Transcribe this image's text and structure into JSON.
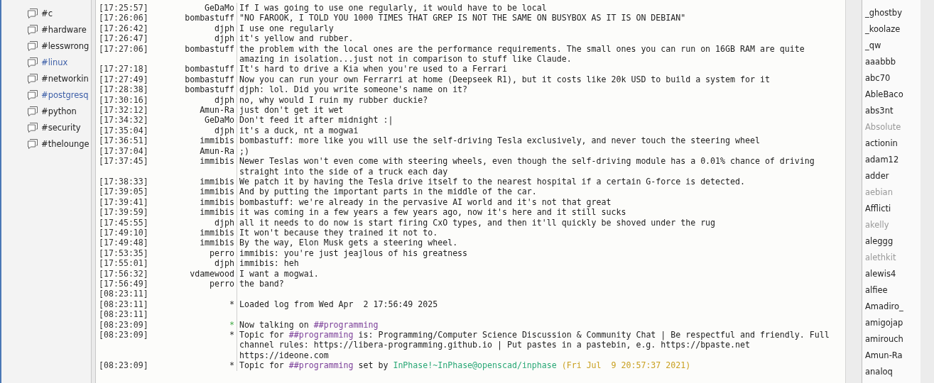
{
  "channels": [
    {
      "name": "#c",
      "unread": false
    },
    {
      "name": "#hardware",
      "unread": false
    },
    {
      "name": "#lesswrong",
      "unread": false
    },
    {
      "name": "#linux",
      "unread": true
    },
    {
      "name": "#networkin",
      "unread": false
    },
    {
      "name": "#postgresq",
      "unread": true
    },
    {
      "name": "#python",
      "unread": false
    },
    {
      "name": "#security",
      "unread": false
    },
    {
      "name": "#thelounge",
      "unread": false
    }
  ],
  "messages": [
    {
      "time": "[17:25:57]",
      "nick": "GeDaMo",
      "kind": "chat",
      "parts": [
        {
          "kind": "text",
          "text": "If I was going to use one regularly, it would have to be local"
        }
      ]
    },
    {
      "time": "[17:26:06]",
      "nick": "bombastuff",
      "kind": "chat",
      "parts": [
        {
          "kind": "text",
          "text": "\"NO FAROOK, I TOLD YOU 1000 TIMES THAT GREP IS NOT THE SAME ON BUSYBOX AS IT IS ON DEBIAN\""
        }
      ]
    },
    {
      "time": "[17:26:42]",
      "nick": "djph",
      "kind": "chat",
      "parts": [
        {
          "kind": "text",
          "text": "I use one regularly"
        }
      ]
    },
    {
      "time": "[17:26:47]",
      "nick": "djph",
      "kind": "chat",
      "parts": [
        {
          "kind": "text",
          "text": "it's yellow and rubber."
        }
      ]
    },
    {
      "time": "[17:27:06]",
      "nick": "bombastuff",
      "kind": "chat",
      "parts": [
        {
          "kind": "text",
          "text": "the problem with the local ones are the performance requirements. The small ones you can run on 16GB RAM are quite amazing in isolation...just not in comparison to stuff like Claude."
        }
      ]
    },
    {
      "time": "[17:27:18]",
      "nick": "bombastuff",
      "kind": "chat",
      "parts": [
        {
          "kind": "text",
          "text": "It's hard to drive a Kia when you're used to a Ferrari"
        }
      ]
    },
    {
      "time": "[17:27:49]",
      "nick": "bombastuff",
      "kind": "chat",
      "parts": [
        {
          "kind": "text",
          "text": "Now you can run your own Ferrarri at home (Deepseek R1), but it costs like 20k USD to build a system for it"
        }
      ]
    },
    {
      "time": "[17:28:38]",
      "nick": "bombastuff",
      "kind": "chat",
      "parts": [
        {
          "kind": "text",
          "text": "djph: lol. Did you write someone's name on it?"
        }
      ]
    },
    {
      "time": "[17:30:16]",
      "nick": "djph",
      "kind": "chat",
      "parts": [
        {
          "kind": "text",
          "text": "no, why would I ruin my rubber duckie?"
        }
      ]
    },
    {
      "time": "[17:32:12]",
      "nick": "Amun-Ra",
      "kind": "chat",
      "parts": [
        {
          "kind": "text",
          "text": "just don't get it wet"
        }
      ]
    },
    {
      "time": "[17:34:32]",
      "nick": "GeDaMo",
      "kind": "chat",
      "parts": [
        {
          "kind": "text",
          "text": "Don't feed it after midnight :|"
        }
      ]
    },
    {
      "time": "[17:35:04]",
      "nick": "djph",
      "kind": "chat",
      "parts": [
        {
          "kind": "text",
          "text": "it's a duck, nt a mogwai"
        }
      ]
    },
    {
      "time": "[17:36:51]",
      "nick": "immibis",
      "kind": "chat",
      "parts": [
        {
          "kind": "text",
          "text": "bombastuff: more like you will use the self-driving Tesla exclusively, and never touch the steering wheel"
        }
      ]
    },
    {
      "time": "[17:37:04]",
      "nick": "Amun-Ra",
      "kind": "chat",
      "parts": [
        {
          "kind": "text",
          "text": ";)"
        }
      ]
    },
    {
      "time": "[17:37:45]",
      "nick": "immibis",
      "kind": "chat",
      "parts": [
        {
          "kind": "text",
          "text": "Newer Teslas won't even come with steering wheels, even though the self-driving module has a 0.01% chance of driving straight into the side of a truck each day"
        }
      ]
    },
    {
      "time": "[17:38:33]",
      "nick": "immibis",
      "kind": "chat",
      "parts": [
        {
          "kind": "text",
          "text": "We patch it by having the Tesla drive itself to the nearest hospital if a certain G-force is detected."
        }
      ]
    },
    {
      "time": "[17:39:05]",
      "nick": "immibis",
      "kind": "chat",
      "parts": [
        {
          "kind": "text",
          "text": "And by putting the important parts in the middle of the car."
        }
      ]
    },
    {
      "time": "[17:39:41]",
      "nick": "immibis",
      "kind": "chat",
      "parts": [
        {
          "kind": "text",
          "text": "bombastuff: we're already in the pervasive AI world and it's not that great"
        }
      ]
    },
    {
      "time": "[17:39:59]",
      "nick": "immibis",
      "kind": "chat",
      "parts": [
        {
          "kind": "text",
          "text": "it was coming in a few years a few years ago, now it's here and it still sucks"
        }
      ]
    },
    {
      "time": "[17:45:55]",
      "nick": "djph",
      "kind": "chat",
      "parts": [
        {
          "kind": "text",
          "text": "all it needs to do now is start firing CxO types, and then it'll quickly be shoved under the rug"
        }
      ]
    },
    {
      "time": "[17:49:10]",
      "nick": "immibis",
      "kind": "chat",
      "parts": [
        {
          "kind": "text",
          "text": "It won't because they trained it not to."
        }
      ]
    },
    {
      "time": "[17:49:48]",
      "nick": "immibis",
      "kind": "chat",
      "parts": [
        {
          "kind": "text",
          "text": "By the way, Elon Musk gets a steering wheel."
        }
      ]
    },
    {
      "time": "[17:53:35]",
      "nick": "perro",
      "kind": "chat",
      "parts": [
        {
          "kind": "text",
          "text": "immibis: you're just jeajlous of his greatness"
        }
      ]
    },
    {
      "time": "[17:55:01]",
      "nick": "djph",
      "kind": "chat",
      "parts": [
        {
          "kind": "text",
          "text": "immibis: heh"
        }
      ]
    },
    {
      "time": "[17:56:32]",
      "nick": "vdamewood",
      "kind": "chat",
      "parts": [
        {
          "kind": "text",
          "text": "I want a mogwai."
        }
      ]
    },
    {
      "time": "[17:56:49]",
      "nick": "perro",
      "kind": "chat",
      "parts": [
        {
          "kind": "text",
          "text": "the band?"
        }
      ]
    },
    {
      "time": "[08:23:11]"
    },
    {
      "time": "[08:23:11]",
      "nick": "*",
      "kind": "status",
      "parts": [
        {
          "kind": "text",
          "text": "Loaded log from Wed Apr  2 17:56:49 2025"
        }
      ]
    },
    {
      "time": "[08:23:11]"
    },
    {
      "time": "[08:23:09]",
      "nick": "*",
      "kind": "join",
      "parts": [
        {
          "kind": "text",
          "text": "Now talking on "
        },
        {
          "kind": "channel",
          "text": "##programming"
        }
      ]
    },
    {
      "time": "[08:23:09]",
      "nick": "*",
      "kind": "status",
      "parts": [
        {
          "kind": "text",
          "text": "Topic for "
        },
        {
          "kind": "channel",
          "text": "##programming"
        },
        {
          "kind": "text",
          "text": " is: Programming/Computer Science Discussion & Community Chat | Be respectful and friendly. Full channel rules: https://libera-programming.github.io | Put pastes in a pastebin, e.g. https://bpaste.net https://ideone.com"
        }
      ]
    },
    {
      "time": "[08:23:09]",
      "nick": "*",
      "kind": "status",
      "parts": [
        {
          "kind": "text",
          "text": "Topic for "
        },
        {
          "kind": "channel",
          "text": "##programming"
        },
        {
          "kind": "text",
          "text": " set by "
        },
        {
          "kind": "host",
          "text": "InPhase!~InPhase@openscad/inphase"
        },
        {
          "kind": "date",
          "text": " (Fri Jul  9 20:57:37 2021)"
        }
      ]
    }
  ],
  "users": [
    {
      "name": "_ghostby",
      "away": false
    },
    {
      "name": "_koolaze",
      "away": false
    },
    {
      "name": "_qw",
      "away": false
    },
    {
      "name": "aaabbb",
      "away": false
    },
    {
      "name": "abc70",
      "away": false
    },
    {
      "name": "AbleBaco",
      "away": false
    },
    {
      "name": "abs3nt",
      "away": false
    },
    {
      "name": "Absolute",
      "away": true
    },
    {
      "name": "actionin",
      "away": false
    },
    {
      "name": "adam12",
      "away": false
    },
    {
      "name": "adder",
      "away": false
    },
    {
      "name": "aebian",
      "away": true
    },
    {
      "name": "Afflicti",
      "away": false
    },
    {
      "name": "akelly",
      "away": true
    },
    {
      "name": "aleggg",
      "away": false
    },
    {
      "name": "alethkit",
      "away": true
    },
    {
      "name": "alewis4",
      "away": false
    },
    {
      "name": "alfiee",
      "away": false
    },
    {
      "name": "Amadiro_",
      "away": false
    },
    {
      "name": "amigojap",
      "away": false
    },
    {
      "name": "amirouch",
      "away": false
    },
    {
      "name": "Amun-Ra",
      "away": false
    },
    {
      "name": "analoq",
      "away": false
    }
  ]
}
